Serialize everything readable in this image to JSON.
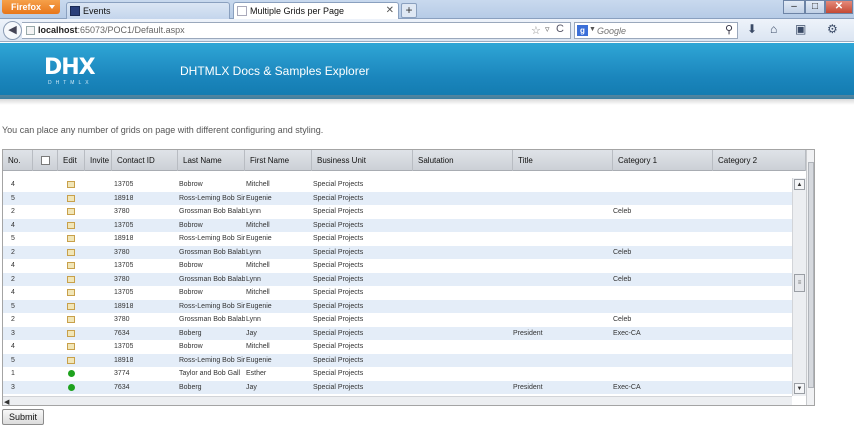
{
  "browser": {
    "menu_button": "Firefox",
    "tabs": [
      {
        "label": "Events",
        "active": false
      },
      {
        "label": "Multiple Grids per Page",
        "active": true
      }
    ],
    "new_tab": "+",
    "window_buttons": {
      "minimize": "–",
      "maximize": "□",
      "close": "✕"
    },
    "url_host": "localhost",
    "url_path": ":65073/POC1/Default.aspx",
    "search_engine": "g",
    "search_placeholder": "Google",
    "icons": {
      "back": "◀",
      "star": "☆",
      "dropdown": "▿",
      "reload": "C",
      "search_go": "🔍",
      "download": "⬇",
      "home": "⌂",
      "addons": "▣",
      "menu": "⚙"
    }
  },
  "banner": {
    "logo_text": "DHX",
    "logo_sub": "DHTMLX",
    "title": "DHTMLX Docs & Samples Explorer",
    "color": "#1b86bd"
  },
  "intro_text": "You can place any number of grids on page with different configuring and styling.",
  "grid": {
    "columns": [
      "No.",
      "",
      "Edit",
      "Invite",
      "Contact ID",
      "Last Name",
      "First Name",
      "Business Unit",
      "Salutation",
      "Title",
      "Category 1",
      "Category 2"
    ],
    "rows": [
      {
        "no": "4",
        "icon": "edit",
        "contact_id": "13705",
        "last_name": "Bobrow",
        "first_name": "Mitchell",
        "business_unit": "Special Projects",
        "salutation": "",
        "title": "",
        "category1": "",
        "category2": ""
      },
      {
        "no": "5",
        "icon": "edit",
        "contact_id": "18918",
        "last_name": "Ross-Leming Bob Sir",
        "first_name": "Eugenie",
        "business_unit": "Special Projects",
        "salutation": "",
        "title": "",
        "category1": "",
        "category2": ""
      },
      {
        "no": "2",
        "icon": "edit",
        "contact_id": "3780",
        "last_name": "Grossman Bob Balab",
        "first_name": "Lynn",
        "business_unit": "Special Projects",
        "salutation": "",
        "title": "",
        "category1": "Celeb",
        "category2": ""
      },
      {
        "no": "4",
        "icon": "edit",
        "contact_id": "13705",
        "last_name": "Bobrow",
        "first_name": "Mitchell",
        "business_unit": "Special Projects",
        "salutation": "",
        "title": "",
        "category1": "",
        "category2": ""
      },
      {
        "no": "5",
        "icon": "edit",
        "contact_id": "18918",
        "last_name": "Ross-Leming Bob Sir",
        "first_name": "Eugenie",
        "business_unit": "Special Projects",
        "salutation": "",
        "title": "",
        "category1": "",
        "category2": ""
      },
      {
        "no": "2",
        "icon": "edit",
        "contact_id": "3780",
        "last_name": "Grossman Bob Balab",
        "first_name": "Lynn",
        "business_unit": "Special Projects",
        "salutation": "",
        "title": "",
        "category1": "Celeb",
        "category2": ""
      },
      {
        "no": "4",
        "icon": "edit",
        "contact_id": "13705",
        "last_name": "Bobrow",
        "first_name": "Mitchell",
        "business_unit": "Special Projects",
        "salutation": "",
        "title": "",
        "category1": "",
        "category2": ""
      },
      {
        "no": "2",
        "icon": "edit",
        "contact_id": "3780",
        "last_name": "Grossman Bob Balab",
        "first_name": "Lynn",
        "business_unit": "Special Projects",
        "salutation": "",
        "title": "",
        "category1": "Celeb",
        "category2": ""
      },
      {
        "no": "4",
        "icon": "edit",
        "contact_id": "13705",
        "last_name": "Bobrow",
        "first_name": "Mitchell",
        "business_unit": "Special Projects",
        "salutation": "",
        "title": "",
        "category1": "",
        "category2": ""
      },
      {
        "no": "5",
        "icon": "edit",
        "contact_id": "18918",
        "last_name": "Ross-Leming Bob Sir",
        "first_name": "Eugenie",
        "business_unit": "Special Projects",
        "salutation": "",
        "title": "",
        "category1": "",
        "category2": ""
      },
      {
        "no": "2",
        "icon": "edit",
        "contact_id": "3780",
        "last_name": "Grossman Bob Balab",
        "first_name": "Lynn",
        "business_unit": "Special Projects",
        "salutation": "",
        "title": "",
        "category1": "Celeb",
        "category2": ""
      },
      {
        "no": "3",
        "icon": "edit",
        "contact_id": "7634",
        "last_name": "Boberg",
        "first_name": "Jay",
        "business_unit": "Special Projects",
        "salutation": "",
        "title": "President",
        "category1": "Exec-CA",
        "category2": ""
      },
      {
        "no": "4",
        "icon": "edit",
        "contact_id": "13705",
        "last_name": "Bobrow",
        "first_name": "Mitchell",
        "business_unit": "Special Projects",
        "salutation": "",
        "title": "",
        "category1": "",
        "category2": ""
      },
      {
        "no": "5",
        "icon": "edit",
        "contact_id": "18918",
        "last_name": "Ross-Leming Bob Sir",
        "first_name": "Eugenie",
        "business_unit": "Special Projects",
        "salutation": "",
        "title": "",
        "category1": "",
        "category2": ""
      },
      {
        "no": "1",
        "icon": "dot",
        "contact_id": "3774",
        "last_name": "Taylor and Bob Gall",
        "first_name": "Esther",
        "business_unit": "Special Projects",
        "salutation": "",
        "title": "",
        "category1": "",
        "category2": ""
      },
      {
        "no": "3",
        "icon": "dot",
        "contact_id": "7634",
        "last_name": "Boberg",
        "first_name": "Jay",
        "business_unit": "Special Projects",
        "salutation": "",
        "title": "President",
        "category1": "Exec-CA",
        "category2": ""
      }
    ]
  },
  "submit_label": "Submit"
}
